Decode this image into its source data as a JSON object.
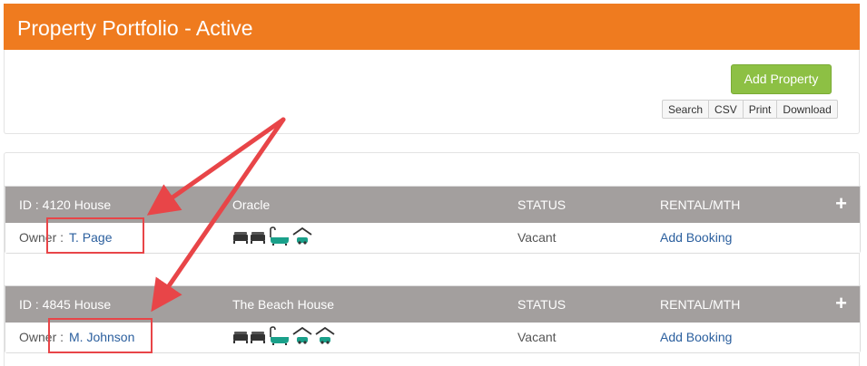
{
  "page": {
    "title": "Property Portfolio - Active"
  },
  "toolbar": {
    "add_label": "Add Property",
    "buttons": [
      "Search",
      "CSV",
      "Print",
      "Download"
    ]
  },
  "columns": {
    "status": "STATUS",
    "rental": "RENTAL/MTH"
  },
  "properties": [
    {
      "id_label": "ID : 4120 House",
      "name": "Oracle",
      "owner_prefix": "Owner : ",
      "owner": "T. Page",
      "status": "Vacant",
      "action": "Add Booking",
      "amenities": [
        "bed-icon",
        "bed-icon",
        "bath-icon",
        "garage-icon"
      ]
    },
    {
      "id_label": "ID : 4845 House",
      "name": "The Beach House",
      "owner_prefix": "Owner : ",
      "owner": "M. Johnson",
      "status": "Vacant",
      "action": "Add Booking",
      "amenities": [
        "bed-icon",
        "bed-icon",
        "bath-icon",
        "garage-icon",
        "garage-icon"
      ]
    }
  ],
  "colors": {
    "header": "#ef7b1f",
    "add_button": "#8dc044",
    "row_header": "#a39f9e",
    "annotation": "#e84548",
    "link": "#2b5f9e"
  }
}
